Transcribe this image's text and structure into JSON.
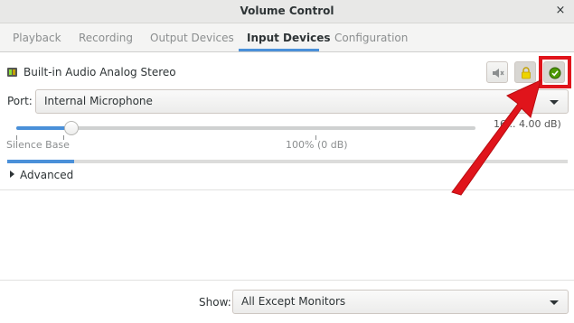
{
  "window": {
    "title": "Volume Control",
    "close_glyph": "×"
  },
  "tabs": [
    {
      "label": "Playback"
    },
    {
      "label": "Recording"
    },
    {
      "label": "Output Devices"
    },
    {
      "label": "Input Devices"
    },
    {
      "label": "Configuration"
    }
  ],
  "active_tab": "Input Devices",
  "device": {
    "name": "Built-in Audio Analog Stereo",
    "icon": "microphone-icon",
    "buttons": [
      {
        "name": "mute",
        "icon": "mute-speaker-icon"
      },
      {
        "name": "lock-channels",
        "icon": "lock-icon"
      },
      {
        "name": "set-fallback",
        "icon": "checkmark-circle-icon"
      }
    ]
  },
  "port": {
    "label": "Port:",
    "value": "Internal Microphone"
  },
  "volume": {
    "level": 0.12,
    "scale_left": "Silence Base",
    "scale_center": "100% (0 dB)",
    "value_text": "16... 4.00 dB)"
  },
  "peak_level": 0.12,
  "advanced_label": "Advanced",
  "show": {
    "label": "Show:",
    "value": "All Except Monitors"
  },
  "colors": {
    "accent": "#4a90d9",
    "highlight": "#e0141b"
  }
}
